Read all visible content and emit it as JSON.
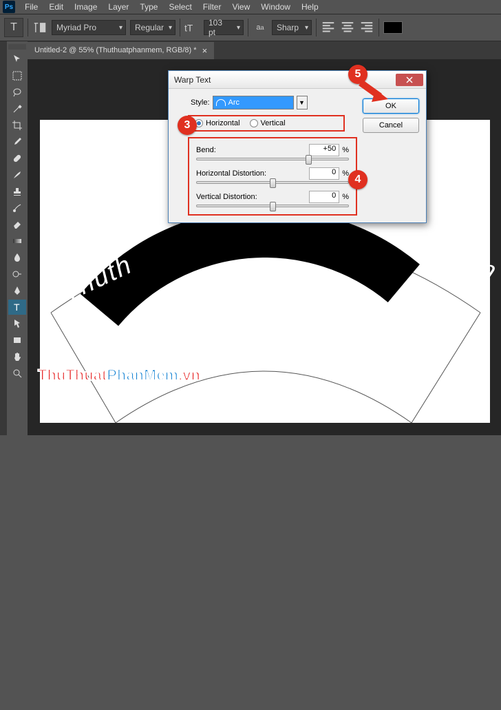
{
  "app": {
    "name": "Ps"
  },
  "menu": [
    "File",
    "Edit",
    "Image",
    "Layer",
    "Type",
    "Select",
    "Filter",
    "View",
    "Window",
    "Help"
  ],
  "options": {
    "font_family": "Myriad Pro",
    "font_style": "Regular",
    "font_size": "103 pt",
    "anti_alias": "Sharp"
  },
  "document": {
    "tab_title": "Untitled-2 @ 55% (Thuthuatphanmem, RGB/8) *",
    "arc_text_left": "Thuth",
    "arc_text_right": "m"
  },
  "watermark": {
    "part1": "ThuThuat",
    "part2": "PhanMem",
    "part3": ".vn"
  },
  "dialog": {
    "title": "Warp Text",
    "style_label": "Style:",
    "style_value": "Arc",
    "orient_h": "Horizontal",
    "orient_v": "Vertical",
    "bend_label": "Bend:",
    "bend_value": "+50",
    "hdist_label": "Horizontal Distortion:",
    "hdist_value": "0",
    "vdist_label": "Vertical Distortion:",
    "vdist_value": "0",
    "pct": "%",
    "ok": "OK",
    "cancel": "Cancel"
  },
  "annot": {
    "n3": "3",
    "n4": "4",
    "n5": "5"
  }
}
